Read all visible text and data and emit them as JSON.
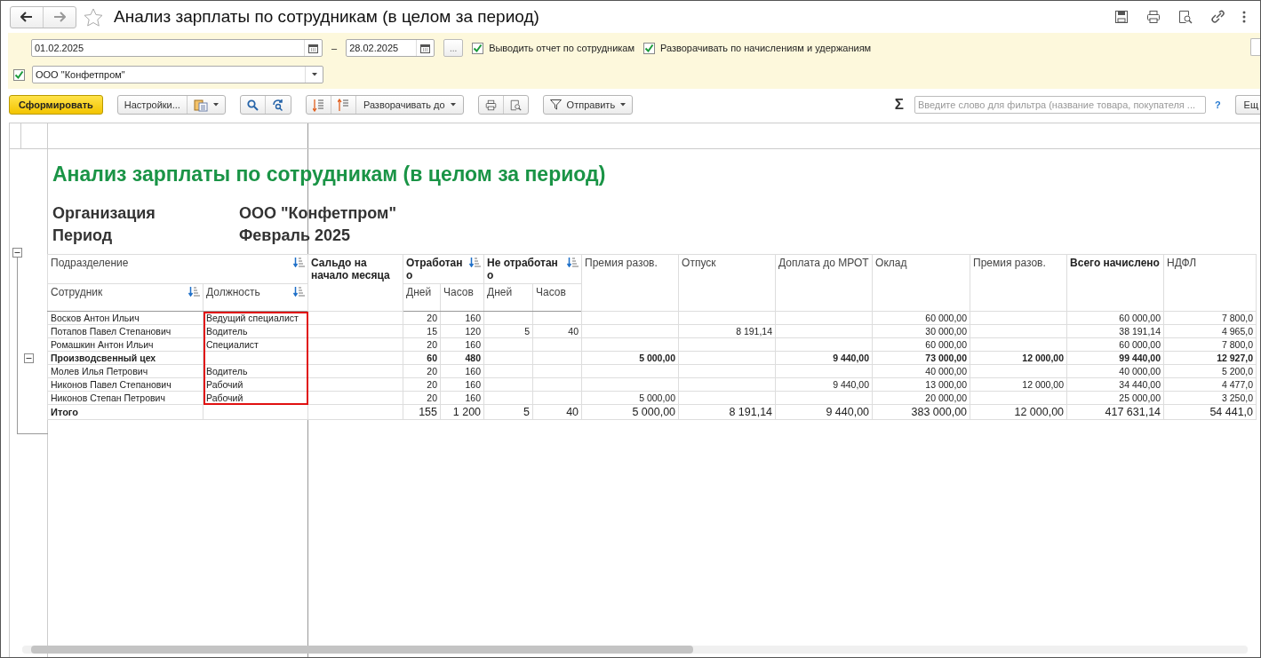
{
  "window": {
    "title": "Анализ зарплаты по сотрудникам (в целом за период)"
  },
  "filters": {
    "date_from": "01.02.2025",
    "dash": "–",
    "date_to": "28.02.2025",
    "more_button": "...",
    "options": [
      {
        "label": "Выводить отчет по сотрудникам",
        "checked": true
      },
      {
        "label": "Разворачивать по начислениям и удержаниям",
        "checked": true
      }
    ],
    "organization": {
      "checked": true,
      "value": "ООО \"Конфетпром\""
    }
  },
  "toolbar": {
    "generate": "Сформировать",
    "settings": "Настройки...",
    "expand_to": "Разворачивать до",
    "send": "Отправить",
    "sum_sign": "Σ",
    "filter_placeholder": "Введите слово для фильтра (название товара, покупателя ...",
    "help": "?",
    "more": "Ещ"
  },
  "report": {
    "title": "Анализ зарплаты по сотрудникам (в целом за период)",
    "params": [
      {
        "label": "Организация",
        "value": "ООО \"Конфетпром\""
      },
      {
        "label": "Период",
        "value": "Февраль 2025"
      }
    ],
    "header": {
      "subdivision": "Подразделение",
      "employee": "Сотрудник",
      "position": "Должность",
      "columns": [
        {
          "label": "Сальдо на начало месяца",
          "bold": true,
          "sortable": false
        },
        {
          "label": "Отработано",
          "bold": true,
          "sortable": true,
          "sub": [
            "Дней",
            "Часов"
          ]
        },
        {
          "label": "Не отработано",
          "bold": true,
          "sortable": true,
          "sub": [
            "Дней",
            "Часов"
          ]
        },
        {
          "label": "Премия разов.",
          "bold": false,
          "sortable": false
        },
        {
          "label": "Отпуск",
          "bold": false,
          "sortable": false
        },
        {
          "label": "Доплата до МРОТ",
          "bold": false,
          "sortable": false
        },
        {
          "label": "Оклад",
          "bold": false,
          "sortable": false
        },
        {
          "label": "Премия разов.",
          "bold": false,
          "sortable": false
        },
        {
          "label": "Всего начислено",
          "bold": true,
          "sortable": false
        },
        {
          "label": "НДФЛ",
          "bold": false,
          "sortable": false
        }
      ]
    },
    "highlight_position_column": true,
    "rows": [
      {
        "kind": "employee",
        "name": "Восков Антон Ильич",
        "position": "Ведущий специалист",
        "cells": [
          "",
          "20",
          "160",
          "",
          "",
          "",
          "",
          "",
          "60 000,00",
          "",
          "60 000,00",
          "7 800,0"
        ]
      },
      {
        "kind": "employee",
        "name": "Потапов Павел Степанович",
        "position": "Водитель",
        "cells": [
          "",
          "15",
          "120",
          "5",
          "40",
          "",
          "8 191,14",
          "",
          "30 000,00",
          "",
          "38 191,14",
          "4 965,0"
        ]
      },
      {
        "kind": "employee",
        "name": "Ромашкин Антон Ильич",
        "position": "Специалист",
        "cells": [
          "",
          "20",
          "160",
          "",
          "",
          "",
          "",
          "",
          "60 000,00",
          "",
          "60 000,00",
          "7 800,0"
        ]
      },
      {
        "kind": "group",
        "name": "Производсвенный цех",
        "position": "",
        "cells": [
          "",
          "60",
          "480",
          "",
          "",
          "5 000,00",
          "",
          "9 440,00",
          "73 000,00",
          "12 000,00",
          "99 440,00",
          "12 927,0"
        ]
      },
      {
        "kind": "employee",
        "name": "Молев Илья Петрович",
        "position": "Водитель",
        "cells": [
          "",
          "20",
          "160",
          "",
          "",
          "",
          "",
          "",
          "40 000,00",
          "",
          "40 000,00",
          "5 200,0"
        ]
      },
      {
        "kind": "employee",
        "name": "Никонов Павел Степанович",
        "position": "Рабочий",
        "cells": [
          "",
          "20",
          "160",
          "",
          "",
          "",
          "",
          "9 440,00",
          "13 000,00",
          "12 000,00",
          "34 440,00",
          "4 477,0"
        ]
      },
      {
        "kind": "employee",
        "name": "Никонов Степан Петрович",
        "position": "Рабочий",
        "cells": [
          "",
          "20",
          "160",
          "",
          "",
          "5 000,00",
          "",
          "",
          "20 000,00",
          "",
          "25 000,00",
          "3 250,0"
        ]
      },
      {
        "kind": "total",
        "name": "Итого",
        "position": "",
        "cells": [
          "",
          "155",
          "1 200",
          "5",
          "40",
          "5 000,00",
          "8 191,14",
          "9 440,00",
          "383 000,00",
          "12 000,00",
          "417 631,14",
          "54 441,0"
        ]
      }
    ]
  }
}
